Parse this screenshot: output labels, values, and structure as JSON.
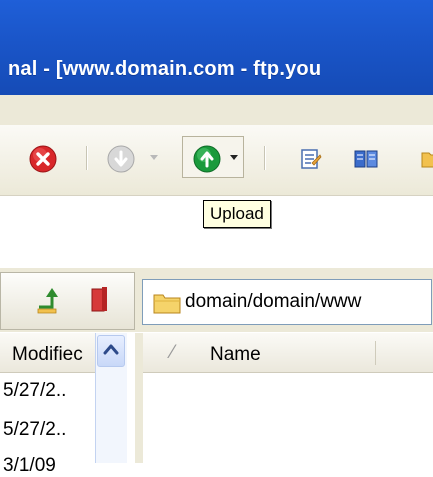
{
  "window": {
    "title": "nal - [www.domain.com - ftp.you"
  },
  "toolbar": {
    "icons": [
      "stop-icon",
      "download-icon",
      "upload-icon",
      "dropdown-arrow-icon",
      "edit-file-icon",
      "queue-icon",
      "folder-icon"
    ],
    "upload_tooltip": "Upload"
  },
  "remote_panel": {
    "path": "domain/domain/www",
    "columns": [
      "Name"
    ]
  },
  "local_panel": {
    "column_modified": "Modifiec",
    "rows": [
      "5/27/2..",
      "5/27/2..",
      "3/1/09"
    ]
  },
  "colors": {
    "titlebar": "#1a55c8",
    "chrome": "#ece9d8",
    "stop_red": "#d8272a",
    "upload_green": "#1a9a3c"
  }
}
